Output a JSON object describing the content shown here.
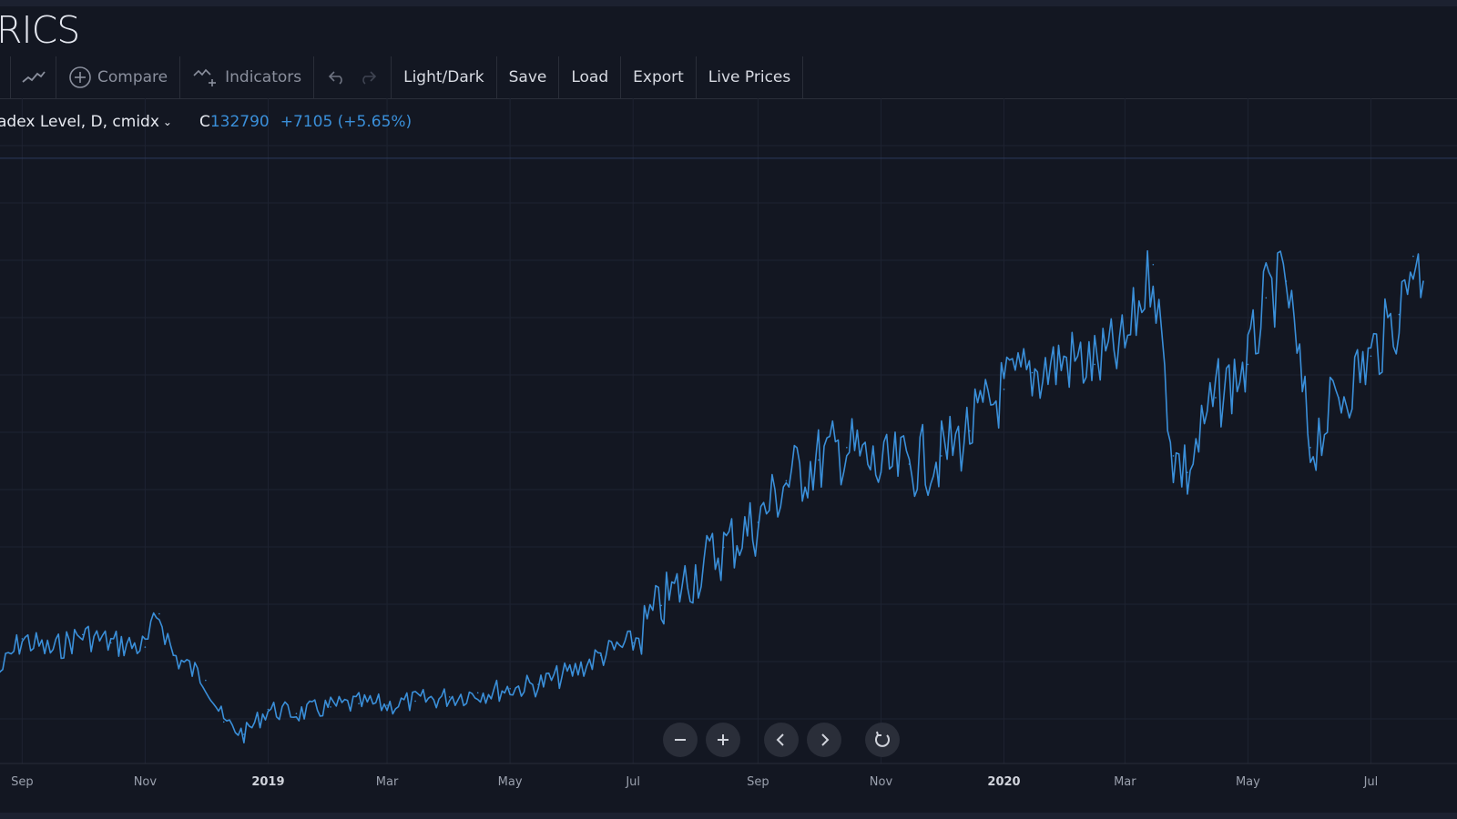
{
  "app": {
    "brand": "RICS"
  },
  "toolbar": {
    "compare_label": "Compare",
    "indicators_label": "Indicators",
    "lightdark_label": "Light/Dark",
    "save_label": "Save",
    "load_label": "Load",
    "export_label": "Export",
    "live_prices_label": "Live Prices"
  },
  "legend": {
    "symbol": "adex Level, D, cmidx",
    "close_prefix": "C",
    "close_value": "132790",
    "change": "+7105 (+5.65%)"
  },
  "icons": {
    "line_style": "line-chart-icon",
    "compare": "plus-circle-icon",
    "indicators": "indicators-icon",
    "undo": "undo-icon",
    "redo": "redo-icon",
    "zoom_out": "minus-icon",
    "zoom_in": "plus-icon",
    "scroll_left": "chevron-left-icon",
    "scroll_right": "chevron-right-icon",
    "reset": "reset-icon"
  },
  "colors": {
    "background": "#131722",
    "line": "#3a8fd9",
    "grid": "#1e2331",
    "text": "#d1d4dc"
  },
  "chart_data": {
    "type": "line",
    "title": "",
    "xlabel": "",
    "ylabel": "",
    "x_ticks": [
      "Sep",
      "Nov",
      "2019",
      "Mar",
      "May",
      "Jul",
      "Sep",
      "Nov",
      "2020",
      "Mar",
      "May",
      "Jul"
    ],
    "x_range": [
      "2018-08-21",
      "2020-07-27"
    ],
    "grid": true,
    "legend": "none",
    "price_line": 132790,
    "ylim": [
      60000,
      140000
    ],
    "series": [
      {
        "x": [
          "2018-08-21",
          "2018-09-01",
          "2018-09-15",
          "2018-10-01",
          "2018-10-15",
          "2018-11-01",
          "2018-11-08",
          "2018-11-15",
          "2018-12-01",
          "2018-12-10",
          "2018-12-20",
          "2019-01-01",
          "2019-01-15",
          "2019-02-01",
          "2019-02-15",
          "2019-03-01",
          "2019-03-15",
          "2019-04-01",
          "2019-04-15",
          "2019-05-01",
          "2019-05-15",
          "2019-06-01",
          "2019-06-15",
          "2019-07-01",
          "2019-07-15",
          "2019-08-01",
          "2019-08-15",
          "2019-09-01",
          "2019-09-15",
          "2019-10-01",
          "2019-10-15",
          "2019-11-01",
          "2019-11-15",
          "2019-12-01",
          "2019-12-15",
          "2020-01-01",
          "2020-01-15",
          "2020-02-01",
          "2020-02-15",
          "2020-03-01",
          "2020-03-15",
          "2020-03-25",
          "2020-04-01",
          "2020-04-15",
          "2020-05-01",
          "2020-05-10",
          "2020-05-20",
          "2020-06-01",
          "2020-06-15",
          "2020-07-01",
          "2020-07-15",
          "2020-07-22",
          "2020-07-27"
        ],
        "y": [
          71000,
          75000,
          73500,
          75500,
          74500,
          74000,
          78000,
          73000,
          70000,
          65000,
          63500,
          66500,
          66000,
          66800,
          67200,
          67000,
          67500,
          68000,
          68500,
          69000,
          69500,
          71000,
          73000,
          74500,
          79000,
          83000,
          86000,
          89000,
          94000,
          96500,
          98000,
          95000,
          96000,
          97000,
          100000,
          105000,
          107000,
          108500,
          108000,
          110000,
          120000,
          97000,
          95000,
          104000,
          108000,
          116000,
          118000,
          98000,
          104000,
          109000,
          114000,
          121000,
          118000
        ]
      }
    ]
  }
}
